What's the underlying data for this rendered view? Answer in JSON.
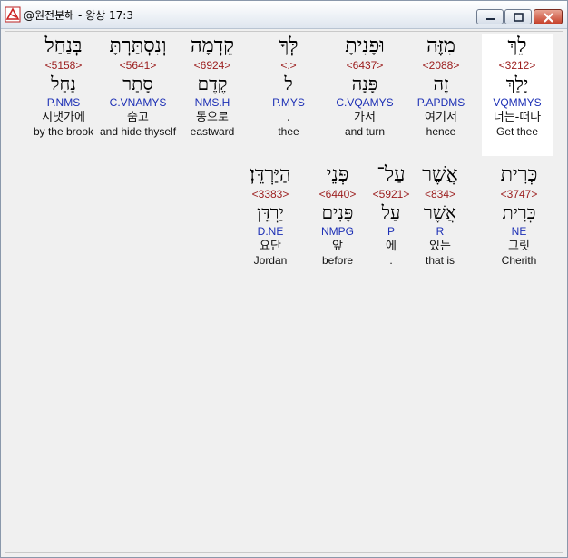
{
  "window": {
    "title": "@원전분해 - 왕상 17:3"
  },
  "verse": {
    "row1": [
      {
        "hebrew": "לֵךְ",
        "strong": "<3212>",
        "lemma": "יָלַךְ",
        "morph": "VQMMYS",
        "korean": "너는-떠나",
        "english": "Get thee"
      },
      {
        "hebrew": "מִזֶּה",
        "strong": "<2088>",
        "lemma": "זֶה",
        "morph": "P.APDMS",
        "korean": "여기서",
        "english": "hence"
      },
      {
        "hebrew": "וּפָנִיתָ",
        "strong": "<6437>",
        "lemma": "פָּנָה",
        "morph": "C.VQAMYS",
        "korean": "가서",
        "english": "and turn"
      },
      {
        "hebrew": "לְּךָ",
        "strong": "<.>",
        "lemma": "ל",
        "morph": "P.MYS",
        "korean": ".",
        "english": "thee"
      },
      {
        "hebrew": "קֵדְמָה",
        "strong": "<6924>",
        "lemma": "קֶדֶם",
        "morph": "NMS.H",
        "korean": "동으로",
        "english": "eastward"
      },
      {
        "hebrew": "וְנִסְתַּרְתָּ",
        "strong": "<5641>",
        "lemma": "סָתַר",
        "morph": "C.VNAMYS",
        "korean": "숨고",
        "english": "and hide thyself"
      },
      {
        "hebrew": "בְּנַחַל",
        "strong": "<5158>",
        "lemma": "נַחַל",
        "morph": "P.NMS",
        "korean": "시냇가에",
        "english": "by the brook"
      }
    ],
    "row2": [
      {
        "hebrew": "כְּרִית",
        "strong": "<3747>",
        "lemma": "כְּרִית",
        "morph": "NE",
        "korean": "그릿",
        "english": "Cherith"
      },
      {
        "hebrew": "אֲשֶׁר",
        "strong": "<834>",
        "lemma": "אֲשֶׁר",
        "morph": "R",
        "korean": "있는",
        "english": "that is"
      },
      {
        "hebrew": "עַל־",
        "strong": "<5921>",
        "lemma": "עַל",
        "morph": "P",
        "korean": "에",
        "english": "."
      },
      {
        "hebrew": "פְּנֵי",
        "strong": "<6440>",
        "lemma": "פָּנִים",
        "morph": "NMPG",
        "korean": "앞",
        "english": "before"
      },
      {
        "hebrew": "הַיַּרְדֵּן׃",
        "strong": "<3383>",
        "lemma": "יַרְדֵּן",
        "morph": "D.NE",
        "korean": "요단",
        "english": "Jordan"
      }
    ]
  },
  "colors": {
    "strong": "#9b1c1c",
    "morph": "#1c2fb5",
    "highlight": "#ffffff"
  },
  "icons": {
    "app": "bible-app-icon",
    "minimize": "minimize-icon",
    "maximize": "maximize-icon",
    "close": "close-icon"
  }
}
